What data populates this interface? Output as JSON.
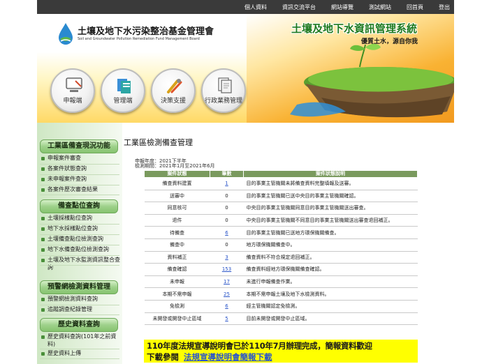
{
  "topnav": {
    "links": [
      "個人資料",
      "資訊交流平台",
      "網站導覽",
      "測試網站",
      "回首頁",
      "登出"
    ]
  },
  "banner": {
    "org_name_cn": "土壤及地下水污染整治基金管理會",
    "org_name_en": "Soil and Groundwater Pollution Remediation Fund Management Board",
    "system_title": "土壤及地下水資訊管理系統",
    "slogan": "優質土水，源自你我",
    "circles": [
      {
        "label": "申報端",
        "icon": "computer-icon"
      },
      {
        "label": "管理端",
        "icon": "folders-icon"
      },
      {
        "label": "決策支援",
        "icon": "tools-icon"
      },
      {
        "label": "行政業務管理",
        "icon": "documents-icon"
      }
    ]
  },
  "sidebar": {
    "sections": [
      {
        "title": "工業區備查現況功能",
        "items": [
          "申報案件審查",
          "各案件狀態查詢",
          "未申報案件查詢",
          "各案件歷次審查結果"
        ]
      },
      {
        "title": "備查點位查詢",
        "items": [
          "土壤採樣點位查詢",
          "地下水採樣點位查詢",
          "土壤備查點位檢測查詢",
          "地下水備查點位檢測查詢",
          "土壤及地下水監測資訊整合查詢"
        ]
      },
      {
        "title": "預警網檢測資料管理",
        "items": [
          "預警網檢測資料查詢",
          "追蹤調查紀錄管理"
        ]
      },
      {
        "title": "歷史資料查詢",
        "items": [
          "歷史資料查詢(101年之前資料)",
          "歷史資料上傳"
        ]
      }
    ]
  },
  "main": {
    "page_title": "工業區檢測備查管理",
    "report_year": "申報年度：2021下半年",
    "inspection_period": "檢測期間：2021年1月至2021年6月",
    "table": {
      "headers": [
        "案件狀態",
        "筆數",
        "案件狀態說明"
      ],
      "rows": [
        {
          "status": "備查資料建置",
          "count": "1",
          "desc": "目的事業主管機關未將備查資料完整填報及送審。",
          "link": true
        },
        {
          "status": "送審中",
          "count": "0",
          "desc": "目的事業主管機關已送中央目的事業主管機關確認。",
          "link": false
        },
        {
          "status": "同意核可",
          "count": "0",
          "desc": "中央目的事業主管機關同意目的事業主管機關送出審查。",
          "link": false
        },
        {
          "status": "退件",
          "count": "0",
          "desc": "中央目的事業主管機關不同意目的事業主管機關送出審查退回補正。",
          "link": false
        },
        {
          "status": "待備查",
          "count": "6",
          "desc": "目的事業主管機關已送地方環保機關備查。",
          "link": true
        },
        {
          "status": "備查中",
          "count": "0",
          "desc": "地方環保機關備查中。",
          "link": false
        },
        {
          "status": "資料補正",
          "count": "3",
          "desc": "備查資料不符合規定退回補正。",
          "link": true
        },
        {
          "status": "備查確認",
          "count": "153",
          "desc": "備查資料經地方環保機關備查確認。",
          "link": true
        },
        {
          "status": "未申報",
          "count": "17",
          "desc": "未進行申報備查作業。",
          "link": true
        },
        {
          "status": "本期不需申報",
          "count": "25",
          "desc": "本期不需申報土壤及地下水檢測資料。",
          "link": true
        },
        {
          "status": "免檢測",
          "count": "6",
          "desc": "經主管機關認定免檢測。",
          "link": true
        },
        {
          "status": "未開發或開發中止區域",
          "count": "5",
          "desc": "目前未開發或開發中止區域。",
          "link": true
        }
      ]
    },
    "notice": {
      "line1": "110年度法規宣導說明會已於110年7月辦理完成，簡報資料歡迎",
      "line2_prefix": "下載參閱",
      "line2_link": "法規宣導說明會簡報下載"
    }
  }
}
